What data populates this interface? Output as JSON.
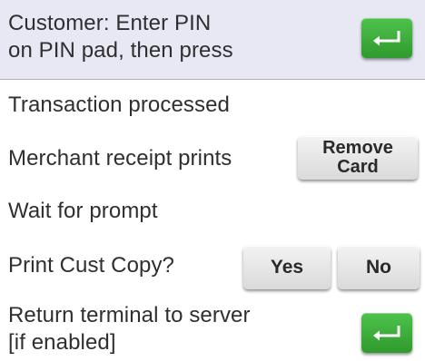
{
  "steps": [
    {
      "line1": "Customer: Enter PIN",
      "line2": "on PIN pad, then press"
    },
    {
      "text": "Transaction processed"
    },
    {
      "text": "Merchant receipt prints"
    },
    {
      "text": "Wait for prompt"
    },
    {
      "text": "Print Cust Copy?"
    },
    {
      "line1": "Return terminal to server",
      "line2": "[if enabled]"
    }
  ],
  "keys": {
    "enter_icon": "enter-return-icon",
    "remove_card_line1": "Remove",
    "remove_card_line2": "Card",
    "yes": "Yes",
    "no": "No"
  },
  "colors": {
    "banner_bg": "#e8e8f5",
    "enter_key": "#3eaf3c",
    "gray_key": "#e6e6e6"
  }
}
